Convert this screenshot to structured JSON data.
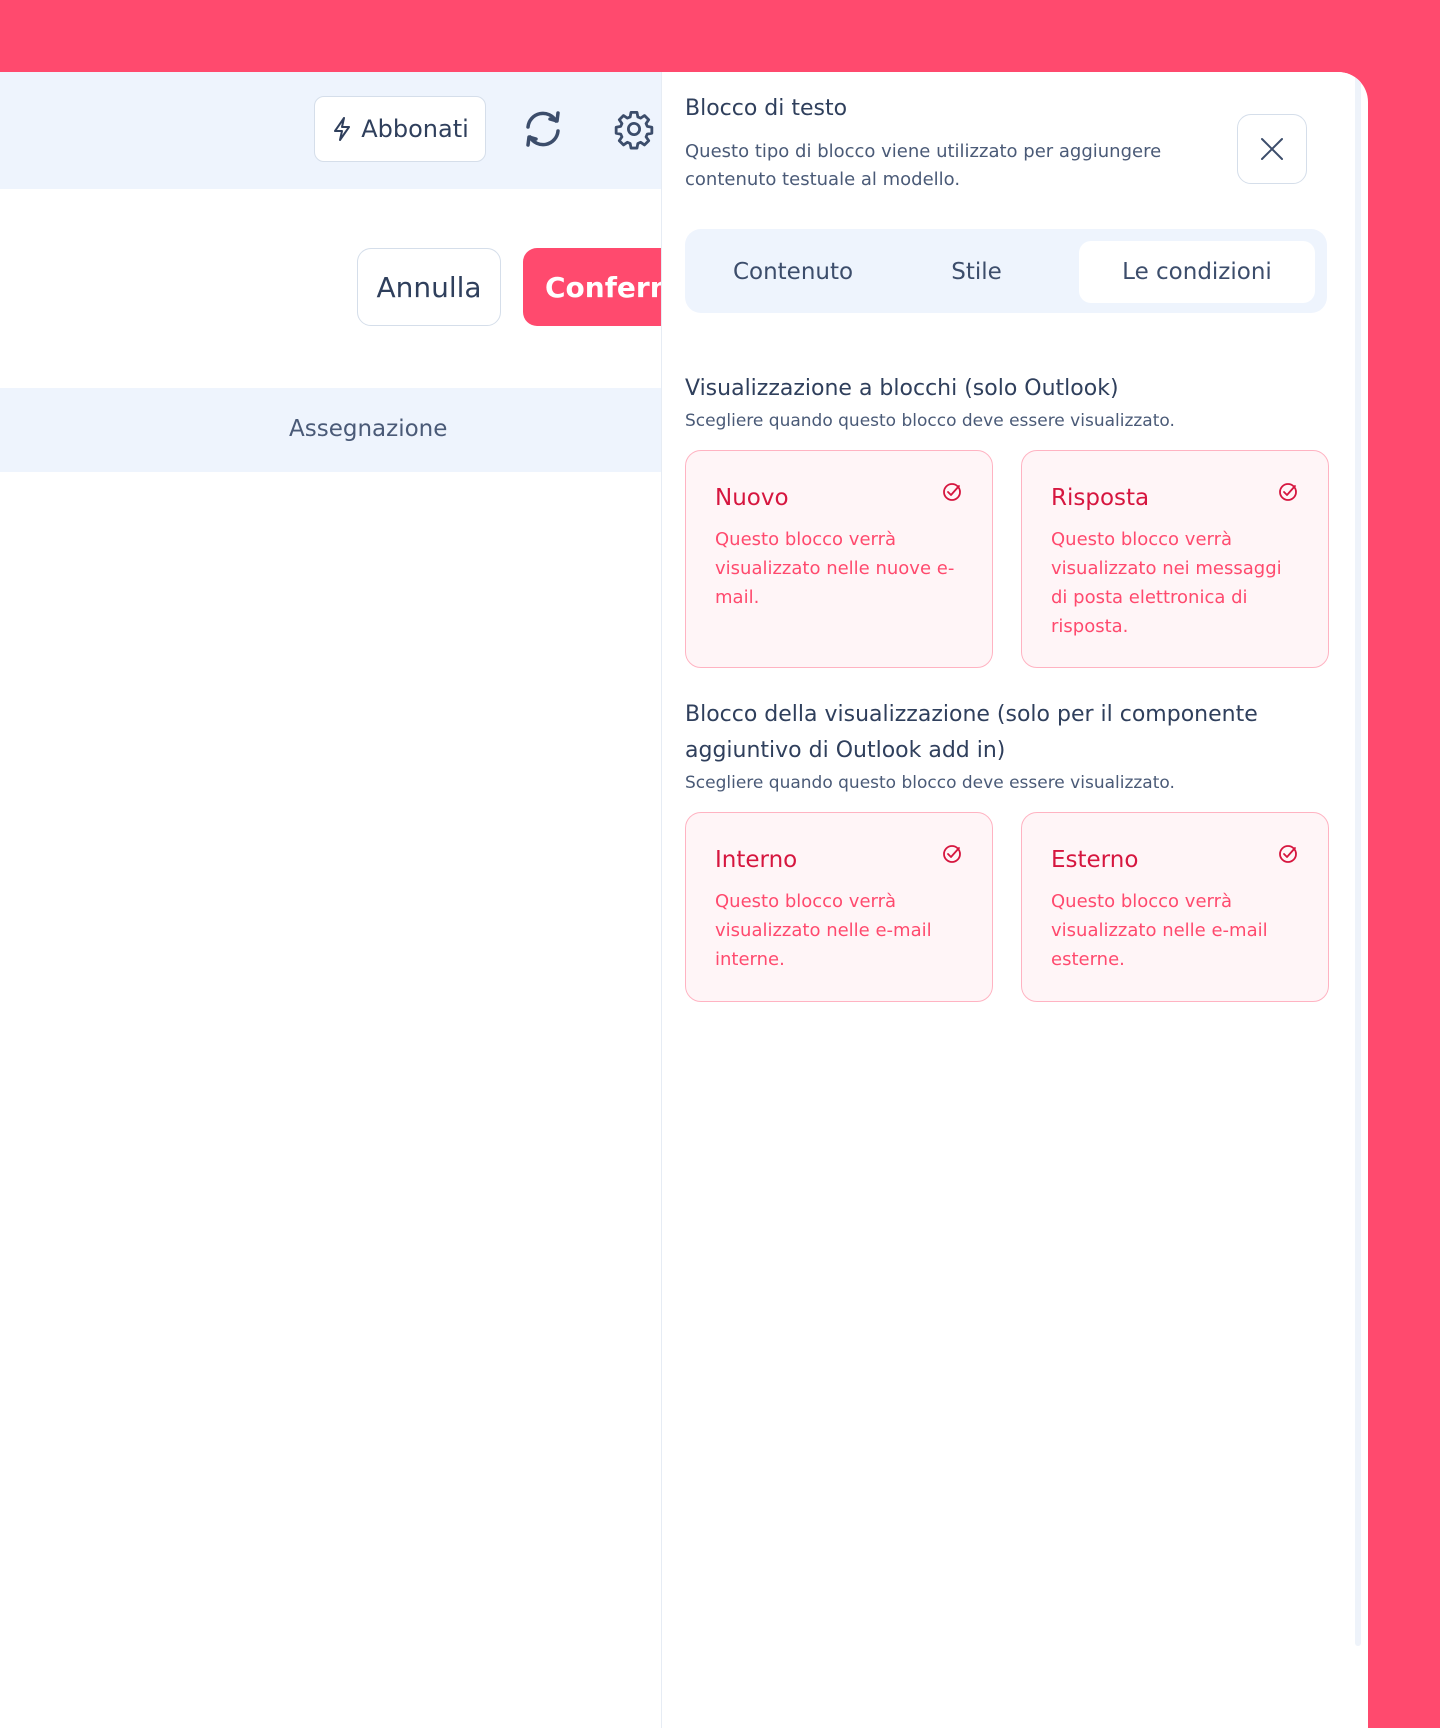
{
  "topbar": {
    "subscribe_label": "Abbonati"
  },
  "actions": {
    "cancel_label": "Annulla",
    "confirm_label": "Conferm"
  },
  "table": {
    "column_header": "Assegnazione"
  },
  "panel": {
    "title": "Blocco di testo",
    "description": "Questo tipo di blocco viene utilizzato per aggiungere contenuto testuale al modello.",
    "tabs": [
      {
        "label": "Contenuto",
        "active": false
      },
      {
        "label": "Stile",
        "active": false
      },
      {
        "label": "Le condizioni",
        "active": true
      }
    ],
    "section1": {
      "title": "Visualizzazione a blocchi (solo Outlook)",
      "subtitle": "Scegliere quando questo blocco deve essere visualizzato.",
      "cards": [
        {
          "title": "Nuovo",
          "description": "Questo blocco verrà visualizzato nelle nuove e-mail."
        },
        {
          "title": "Risposta",
          "description": "Questo blocco verrà visualizzato nei messaggi di posta elettronica di risposta."
        }
      ]
    },
    "section2": {
      "title": "Blocco della visualizzazione (solo per il componente aggiuntivo di Outlook add in)",
      "subtitle": "Scegliere quando questo blocco deve essere visualizzato.",
      "cards": [
        {
          "title": "Interno",
          "description": "Questo blocco verrà visualizzato nelle e-mail interne."
        },
        {
          "title": "Esterno",
          "description": "Questo blocco verrà visualizzato nelle e-mail esterne."
        }
      ]
    }
  },
  "colors": {
    "brand": "#ff4a6e",
    "card_title": "#d6163f",
    "light_bg": "#eef4fd"
  },
  "icons": [
    "lightning-icon",
    "refresh-icon",
    "gear-icon",
    "close-icon",
    "check-circle-icon"
  ]
}
